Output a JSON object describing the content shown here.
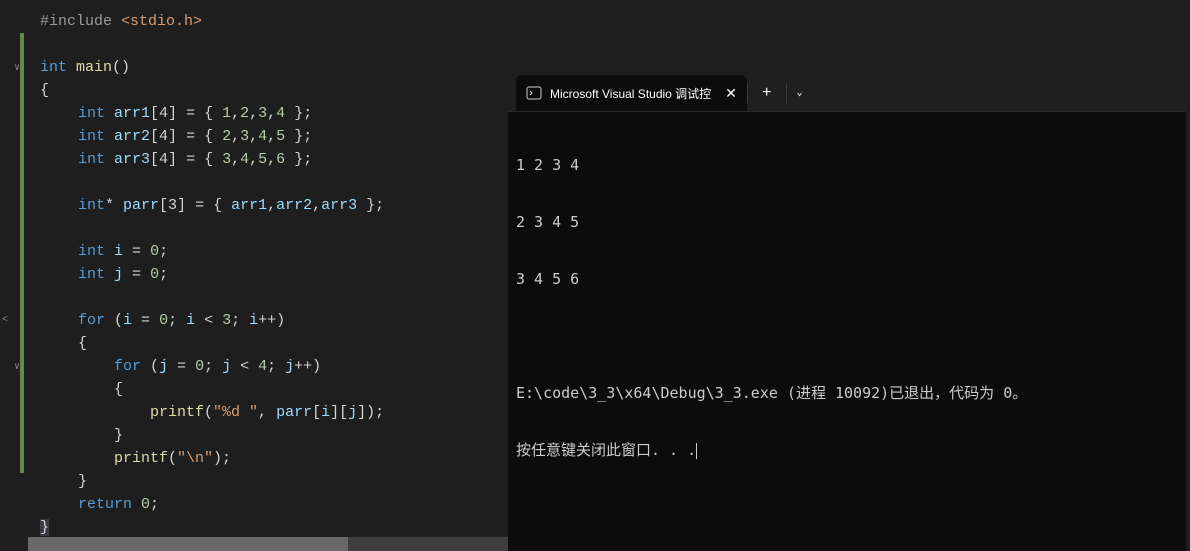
{
  "editor": {
    "lines": {
      "include": {
        "directive": "#include",
        "path": "<stdio.h>"
      },
      "funcDecl": {
        "type": "int",
        "name": "main",
        "parens": "()"
      },
      "openBrace": "{",
      "arr1": {
        "type": "int",
        "name": "arr1",
        "size": "[4]",
        "init": " = { 1,2,3,4 };"
      },
      "arr2": {
        "type": "int",
        "name": "arr2",
        "size": "[4]",
        "init": " = { 2,3,4,5 };"
      },
      "arr3": {
        "type": "int",
        "name": "arr3",
        "size": "[4]",
        "init": " = { 3,4,5,6 };"
      },
      "parr": {
        "type": "int*",
        "name": "parr",
        "size": "[3]",
        "init": " = { arr1,arr2,arr3 };"
      },
      "iDecl": {
        "type": "int",
        "name": "i",
        "init": " = 0;"
      },
      "jDecl": {
        "type": "int",
        "name": "j",
        "init": " = 0;"
      },
      "forOuter": {
        "kw": "for",
        "cond": " (i = 0; i < 3; i++)"
      },
      "outerOpen": "{",
      "forInner": {
        "kw": "for",
        "cond": " (j = 0; j < 4; j++)"
      },
      "innerOpen": "{",
      "printf1": {
        "fn": "printf",
        "args": "(\"%d \", parr[i][j]);"
      },
      "innerClose": "}",
      "printf2": {
        "fn": "printf",
        "args": "(\"\\n\");"
      },
      "outerClose": "}",
      "ret": {
        "kw": "return",
        "val": " 0;"
      },
      "mainClose": "}"
    }
  },
  "terminal": {
    "tabTitle": "Microsoft Visual Studio 调试控",
    "output": {
      "line1": "1 2 3 4",
      "line2": "2 3 4 5",
      "line3": "3 4 5 6",
      "line4": "",
      "status": "E:\\code\\3_3\\x64\\Debug\\3_3.exe (进程 10092)已退出，代码为 0。",
      "prompt": "按任意键关闭此窗口. . ."
    }
  }
}
